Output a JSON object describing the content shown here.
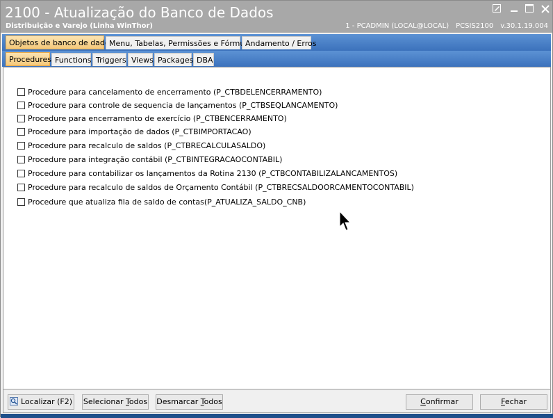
{
  "window": {
    "title": "2100 - Atualização do Banco de Dados",
    "subtitle": "Distribuição e Varejo (Linha WinThor)",
    "connection": "1 - PCADMIN (LOCAL@LOCAL)",
    "module": "PCSIS2100",
    "version": "v.30.1.19.004"
  },
  "main_tabs": [
    {
      "label": "Objetos de banco de dados"
    },
    {
      "label": "Menu, Tabelas, Permissões e Fórmulas"
    },
    {
      "label": "Andamento / Erros"
    }
  ],
  "sub_tabs": [
    {
      "label": "Procedures"
    },
    {
      "label": "Functions"
    },
    {
      "label": "Triggers"
    },
    {
      "label": "Views"
    },
    {
      "label": "Packages"
    },
    {
      "label": "DBA"
    }
  ],
  "procedures": [
    {
      "label": "Procedure para cancelamento de encerramento (P_CTBDELENCERRAMENTO)"
    },
    {
      "label": "Procedure para controle de sequencia de lançamentos (P_CTBSEQLANCAMENTO)"
    },
    {
      "label": "Procedure para encerramento de exercício (P_CTBENCERRAMENTO)"
    },
    {
      "label": "Procedure para importação de dados (P_CTBIMPORTACAO)"
    },
    {
      "label": "Procedure para recalculo de saldos (P_CTBRECALCULASALDO)"
    },
    {
      "label": "Procedure para integração contábil (P_CTBINTEGRACAOCONTABIL)"
    },
    {
      "label": "Procedure para contabilizar os lançamentos da Rotina 2130 (P_CTBCONTABILIZALANCAMENTOS)"
    },
    {
      "label": "Procedure para recalculo de saldos de Orçamento Contábil (P_CTBRECSALDOORCAMENTOCONTABIL)"
    },
    {
      "label": "Procedure que atualiza fila de saldo de contas(P_ATUALIZA_SALDO_CNB)"
    }
  ],
  "buttons": {
    "localizar": "Localizar (F2)",
    "selecionar_todos_prefix": "Selecionar ",
    "selecionar_todos_ul": "T",
    "selecionar_todos_suffix": "odos",
    "desmarcar_todos_prefix": "Desmarcar ",
    "desmarcar_todos_ul": "T",
    "desmarcar_todos_suffix": "odos",
    "confirmar_prefix": "",
    "confirmar_ul": "C",
    "confirmar_suffix": "onfirmar",
    "fechar_prefix": "",
    "fechar_ul": "F",
    "fechar_suffix": "echar"
  },
  "icons": {
    "edit": "edit-icon",
    "minimize": "minimize-icon",
    "maximize": "maximize-icon",
    "close": "close-icon",
    "search": "search-icon",
    "cursor": "mouse-cursor-icon"
  },
  "colors": {
    "titlebar": "#a8a8a8",
    "tab_strip": "#4a82c8",
    "active_tab": "#f5c97a",
    "statusbar": "#1e4f8a"
  }
}
